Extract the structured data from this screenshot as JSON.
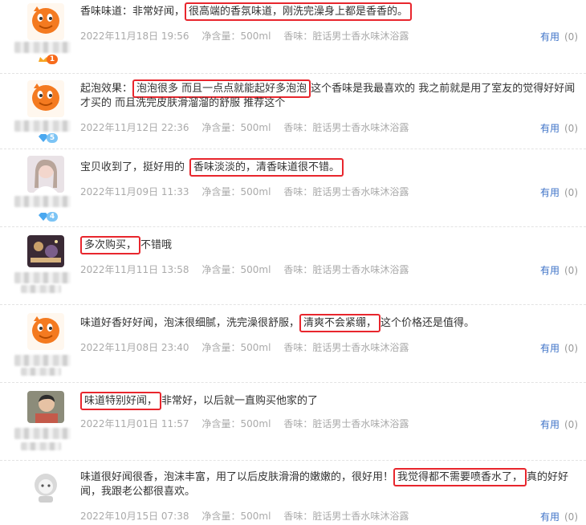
{
  "colors": {
    "highlight": "#e8262d",
    "useful": "#3d72c7",
    "meta": "#aaaaaa"
  },
  "reviews": [
    {
      "text_before": "香味味道：非常好闻，",
      "highlight": "很高端的香氛味道，刚洗完澡身上都是香香的。",
      "text_after": "",
      "date": "2022年11月18日 19:56",
      "volume": "净含量：500ml",
      "product": "香味：脏话男士香水味沐浴露",
      "useful_label": "有用",
      "useful_count": "(0)",
      "avatar": "orange-mascot",
      "level": "1"
    },
    {
      "text_before": "起泡效果：",
      "highlight": "泡泡很多 而且一点点就能起好多泡泡",
      "text_after": "这个香味是我最喜欢的 我之前就是用了室友的觉得好好闻才买的 而且洗完皮肤滑溜溜的舒服 推荐这个",
      "date": "2022年11月12日 22:36",
      "volume": "净含量：500ml",
      "product": "香味：脏话男士香水味沐浴露",
      "useful_label": "有用",
      "useful_count": "(0)",
      "avatar": "orange-mascot",
      "level": "5"
    },
    {
      "text_before": "宝贝收到了，挺好用的",
      "highlight": "香味淡淡的，清香味道很不错。",
      "text_after": "",
      "date": "2022年11月09日 11:33",
      "volume": "净含量：500ml",
      "product": "香味：脏话男士香水味沐浴露",
      "useful_label": "有用",
      "useful_count": "(0)",
      "avatar": "photo-girl",
      "level": "4"
    },
    {
      "text_before": "",
      "highlight": "多次购买，",
      "text_after": "不错哦",
      "date": "2022年11月11日 13:58",
      "volume": "净含量：500ml",
      "product": "香味：脏话男士香水味沐浴露",
      "useful_label": "有用",
      "useful_count": "(0)",
      "avatar": "photo-dark",
      "level": ""
    },
    {
      "text_before": "味道好香好好闻，泡沫很细腻，洗完澡很舒服，",
      "highlight": "清爽不会紧绷，",
      "text_after": "这个价格还是值得。",
      "date": "2022年11月08日 23:40",
      "volume": "净含量：500ml",
      "product": "香味：脏话男士香水味沐浴露",
      "useful_label": "有用",
      "useful_count": "(0)",
      "avatar": "orange-mascot",
      "level": ""
    },
    {
      "text_before": "",
      "highlight": "味道特别好闻，",
      "text_after": "非常好，以后就一直购买他家的了",
      "date": "2022年11月01日 11:57",
      "volume": "净含量：500ml",
      "product": "香味：脏话男士香水味沐浴露",
      "useful_label": "有用",
      "useful_count": "(0)",
      "avatar": "photo-kid",
      "level": ""
    },
    {
      "text_before": "味道很好闻很香，泡沫丰富，用了以后皮肤滑滑的嫩嫩的，很好用！",
      "highlight": "我觉得都不需要喷香水了，",
      "text_after": "真的好好闻，我跟老公都很喜欢。",
      "date": "2022年10月15日 07:38",
      "volume": "净含量：500ml",
      "product": "香味：脏话男士香水味沐浴露",
      "useful_label": "有用",
      "useful_count": "(0)",
      "avatar": "gray-mascot",
      "level": ""
    }
  ]
}
